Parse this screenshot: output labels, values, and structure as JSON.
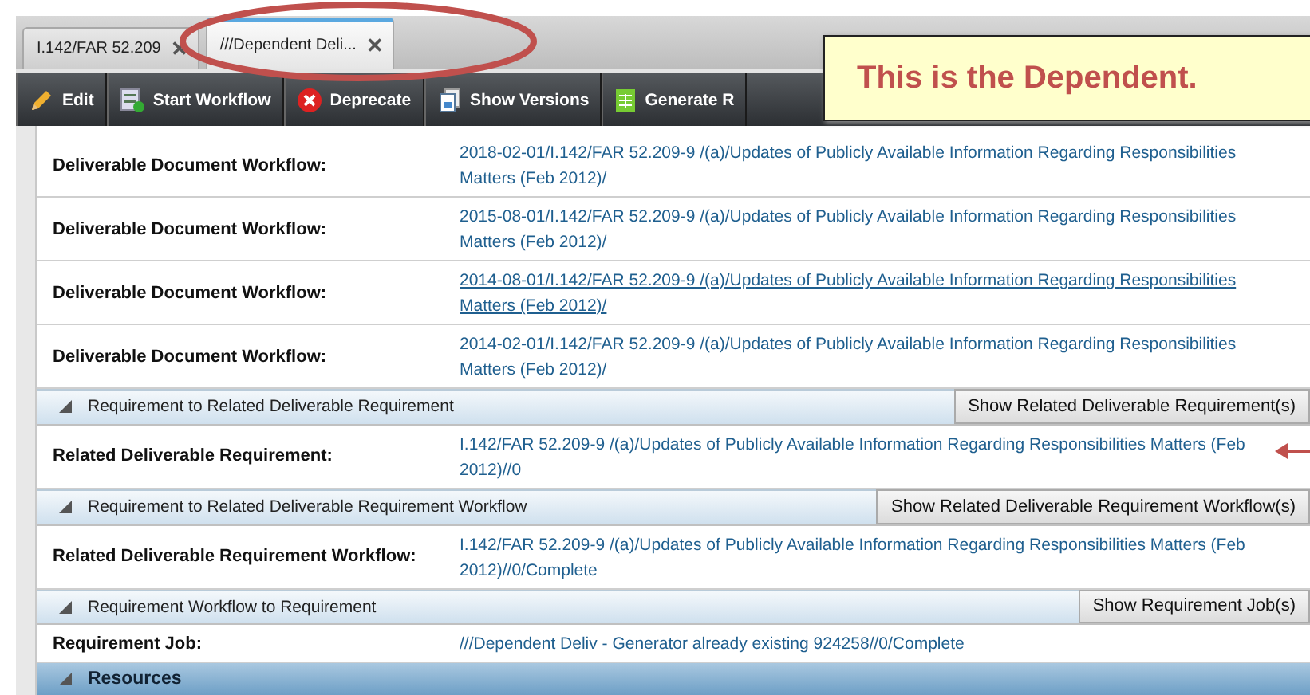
{
  "tabs": [
    {
      "label": "I.142/FAR 52.209",
      "selected": false,
      "close": "✕"
    },
    {
      "label": "///Dependent Deli...",
      "selected": true,
      "close": "✕"
    }
  ],
  "toolbar": [
    {
      "label": "Edit"
    },
    {
      "label": "Start Workflow"
    },
    {
      "label": "Deprecate"
    },
    {
      "label": "Show Versions"
    },
    {
      "label": "Generate R"
    }
  ],
  "callout": {
    "text": "This is the Dependent."
  },
  "rows": [
    {
      "kind": "field",
      "label": "Deliverable Document Workflow:",
      "value": "2018-02-01/I.142/FAR 52.209-9 /(a)/Updates of Publicly Available Information Regarding Responsibilities Matters (Feb 2012)/",
      "hovered": false,
      "arrow": false
    },
    {
      "kind": "field",
      "label": "Deliverable Document Workflow:",
      "value": "2015-08-01/I.142/FAR 52.209-9 /(a)/Updates of Publicly Available Information Regarding Responsibilities Matters (Feb 2012)/",
      "hovered": false,
      "arrow": false
    },
    {
      "kind": "field",
      "label": "Deliverable Document Workflow:",
      "value": "2014-08-01/I.142/FAR 52.209-9 /(a)/Updates of Publicly Available Information Regarding Responsibilities Matters (Feb 2012)/",
      "hovered": true,
      "arrow": false
    },
    {
      "kind": "field",
      "label": "Deliverable Document Workflow:",
      "value": "2014-02-01/I.142/FAR 52.209-9 /(a)/Updates of Publicly Available Information Regarding Responsibilities Matters (Feb 2012)/",
      "hovered": false,
      "arrow": false
    },
    {
      "kind": "section",
      "title": "Requirement to Related Deliverable Requirement",
      "button": "Show Related Deliverable Requirement(s)"
    },
    {
      "kind": "field",
      "label": "Related Deliverable Requirement:",
      "value": "I.142/FAR 52.209-9 /(a)/Updates of Publicly Available Information Regarding Responsibilities Matters (Feb 2012)//0",
      "hovered": false,
      "arrow": true
    },
    {
      "kind": "section",
      "title": "Requirement to Related Deliverable Requirement Workflow",
      "button": "Show Related Deliverable Requirement Workflow(s)"
    },
    {
      "kind": "field",
      "label": "Related Deliverable Requirement Workflow:",
      "value": "I.142/FAR 52.209-9 /(a)/Updates of Publicly Available Information Regarding Responsibilities Matters (Feb 2012)//0/Complete",
      "hovered": false,
      "arrow": false
    },
    {
      "kind": "section",
      "title": "Requirement Workflow to Requirement",
      "button": "Show Requirement Job(s)"
    },
    {
      "kind": "field",
      "label": "Requirement Job:",
      "value": "///Dependent Deliv - Generator already existing 924258//0/Complete",
      "hovered": false,
      "arrow": false
    }
  ],
  "footer": {
    "title": "Resources"
  }
}
